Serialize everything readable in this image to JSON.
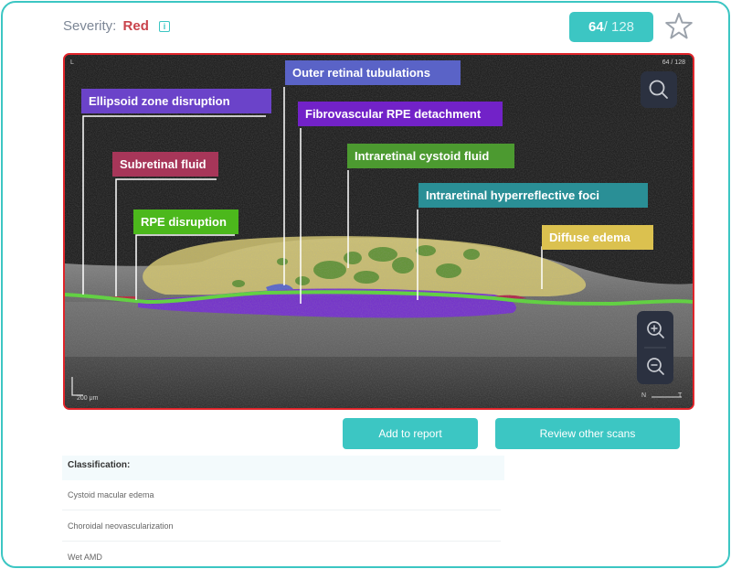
{
  "severity": {
    "label": "Severity:",
    "value": "Red",
    "info_icon": "info-icon",
    "value_color": "#c9434b"
  },
  "slice": {
    "current": "64",
    "total": "/ 128"
  },
  "favorite_icon": "star-outline-icon",
  "scan": {
    "corner_left": "L",
    "corner_right": "64 / 128",
    "scale_bar": "200 μm",
    "orientation": {
      "n": "N",
      "t": "T"
    },
    "search_icon": "search-icon",
    "zoom_in_icon": "zoom-in-icon",
    "zoom_out_icon": "zoom-out-icon",
    "labels": [
      {
        "text": "Ellipsoid zone disruption",
        "color": "#6b43c9"
      },
      {
        "text": "Outer retinal tubulations",
        "color": "#5a63c7"
      },
      {
        "text": "Fibrovascular RPE detachment",
        "color": "#7222c8"
      },
      {
        "text": "Subretinal fluid",
        "color": "#a73659"
      },
      {
        "text": "Intraretinal cystoid fluid",
        "color": "#4c9a30"
      },
      {
        "text": "Intraretinal hyperreflective foci",
        "color": "#2a8f96"
      },
      {
        "text": "RPE disruption",
        "color": "#4cb81c"
      },
      {
        "text": "Diffuse edema",
        "color": "#dbc14f"
      }
    ]
  },
  "actions": {
    "add_to_report": "Add to report",
    "review_other": "Review other scans"
  },
  "classification": {
    "heading": "Classification:",
    "items": [
      "Cystoid macular edema",
      "Choroidal neovascularization",
      "Wet AMD"
    ]
  }
}
